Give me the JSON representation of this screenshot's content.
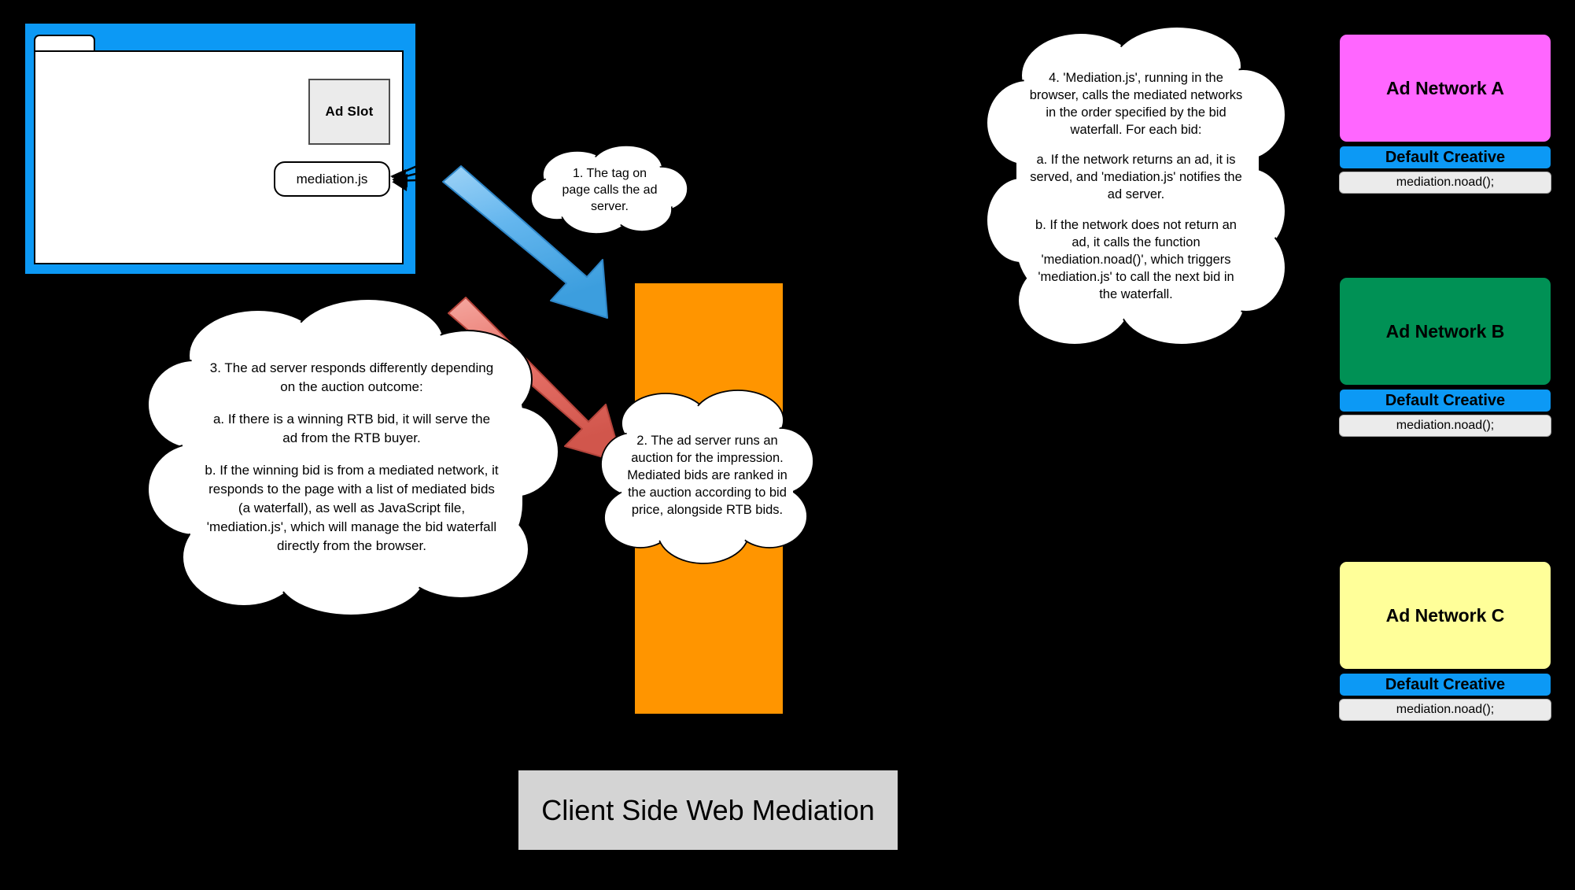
{
  "diagram": {
    "title": "Client Side Web Mediation"
  },
  "browser": {
    "tab_label": "",
    "ad_slot_label": "Ad Slot",
    "mediation_script_label": "mediation.js"
  },
  "ad_server": {
    "label": ""
  },
  "clouds": [
    {
      "id": "cloud-1",
      "lines": [
        "1. The tag on page calls the ad server."
      ]
    },
    {
      "id": "cloud-2",
      "lines": [
        "2. The ad server runs an auction for the impression.  Mediated bids are ranked in the auction according to bid price, alongside RTB bids."
      ]
    },
    {
      "id": "cloud-3",
      "lines": [
        "3. The ad server responds differently depending on the auction outcome:",
        "a. If there is a winning RTB bid, it will serve the ad from the RTB buyer.",
        "b. If the winning bid is from a mediated network, it responds to the page with a list of mediated bids (a waterfall), as well as JavaScript file, 'mediation.js', which will manage the bid waterfall directly from the browser."
      ]
    },
    {
      "id": "cloud-4",
      "lines": [
        "4. 'Mediation.js', running in the browser, calls the mediated networks in the order specified by the bid waterfall.  For each bid:",
        "a. If the network returns an ad, it is served, and 'mediation.js' notifies the ad server.",
        "b. If the network does not return an ad, it calls the function 'mediation.noad()', which triggers 'mediation.js' to call the next bid in the waterfall."
      ]
    }
  ],
  "networks": [
    {
      "name": "Ad Network A",
      "color": "#ff66ff",
      "default_creative_label": "Default Creative",
      "noad_call": "mediation.noad();"
    },
    {
      "name": "Ad Network B",
      "color": "#009155",
      "default_creative_label": "Default Creative",
      "noad_call": "mediation.noad();"
    },
    {
      "name": "Ad Network C",
      "color": "#ffff99",
      "default_creative_label": "Default Creative",
      "noad_call": "mediation.noad();"
    }
  ],
  "colors": {
    "background": "#000000",
    "browser_chrome": "#0c99f5",
    "ad_server": "#ff9500",
    "request_arrow": "#6cb8ee",
    "response_arrow": "#e8736a",
    "default_creative_bar": "#0c99f5",
    "title_plate": "#d4d4d4"
  }
}
